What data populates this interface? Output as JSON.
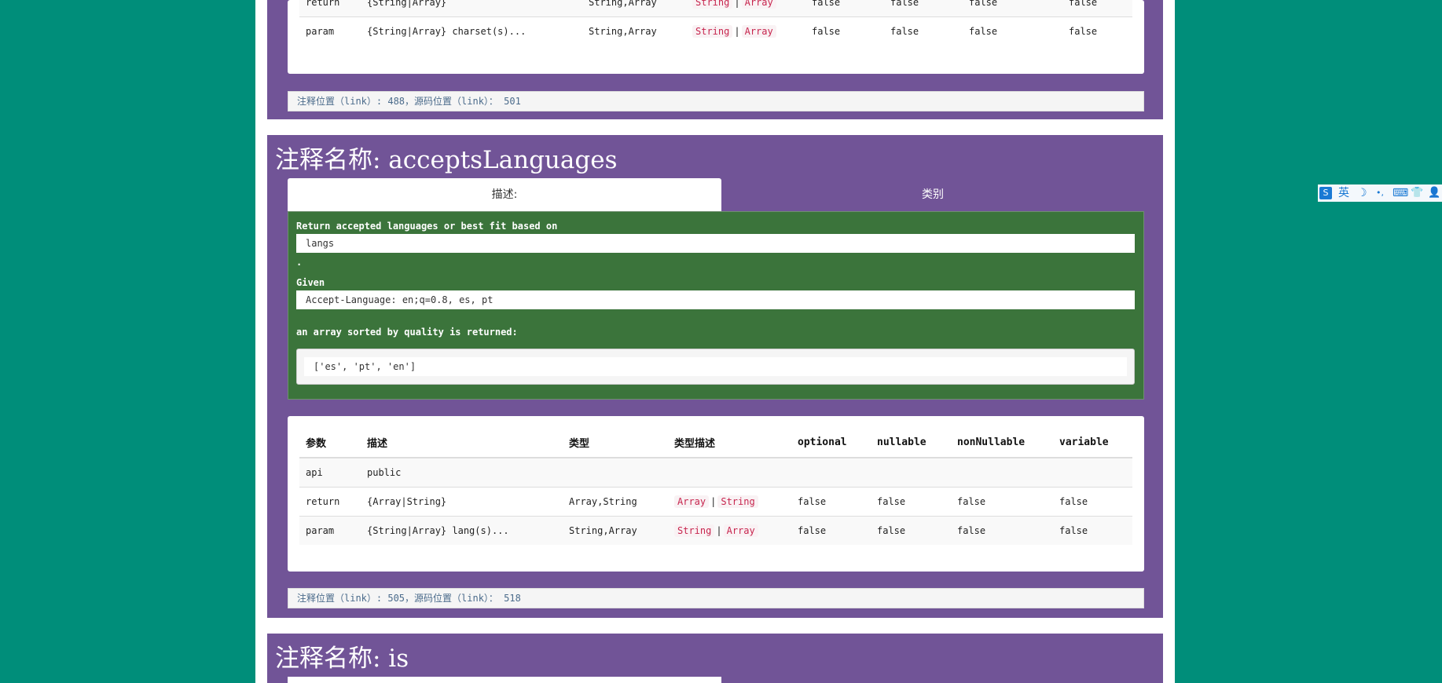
{
  "columns": [
    "参数",
    "描述",
    "类型",
    "类型描述",
    "optional",
    "nullable",
    "nonNullable",
    "variable"
  ],
  "block0": {
    "rows": [
      {
        "p": "return",
        "d": "{String|Array}",
        "t": "String,Array",
        "td": [
          "String",
          "Array"
        ],
        "o": "false",
        "n": "false",
        "nn": "false",
        "v": "false"
      },
      {
        "p": "param",
        "d": "{String|Array} charset(s)...",
        "t": "String,Array",
        "td": [
          "String",
          "Array"
        ],
        "o": "false",
        "n": "false",
        "nn": "false",
        "v": "false"
      }
    ],
    "footer": "注释位置（link）: 488，源码位置（link）： 501"
  },
  "block1": {
    "title": "注释名称: acceptsLanguages",
    "tab_desc": "描述:",
    "tab_category": "类别",
    "desc_line1": "Return accepted languages or best fit based on",
    "desc_code1": "langs",
    "desc_dot": ".",
    "desc_given": "Given",
    "desc_code2": "Accept-Language: en;q=0.8, es, pt",
    "desc_line3": "an array sorted by quality is returned:",
    "desc_pre": "['es', 'pt', 'en']",
    "rows": [
      {
        "p": "api",
        "d": "public",
        "t": "",
        "td": [],
        "o": "",
        "n": "",
        "nn": "",
        "v": ""
      },
      {
        "p": "return",
        "d": "{Array|String}",
        "t": "Array,String",
        "td": [
          "Array",
          "String"
        ],
        "o": "false",
        "n": "false",
        "nn": "false",
        "v": "false"
      },
      {
        "p": "param",
        "d": "{String|Array} lang(s)...",
        "t": "String,Array",
        "td": [
          "String",
          "Array"
        ],
        "o": "false",
        "n": "false",
        "nn": "false",
        "v": "false"
      }
    ],
    "footer": "注释位置（link）: 505，源码位置（link）： 518"
  },
  "block2": {
    "title": "注释名称: is"
  },
  "ime": {
    "logo": "S",
    "lang": "英",
    "moon": "☽",
    "punct": "•,",
    "keyboard": "⌨",
    "skin": "👕",
    "user": "👤"
  }
}
